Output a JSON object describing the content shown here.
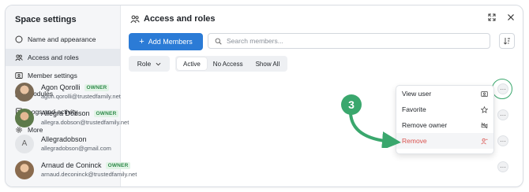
{
  "sidebar": {
    "title": "Space settings",
    "items": [
      {
        "label": "Name and appearance",
        "icon": "circle-icon",
        "active": false
      },
      {
        "label": "Access and roles",
        "icon": "people-icon",
        "active": true
      },
      {
        "label": "Member settings",
        "icon": "id-card-icon",
        "active": false
      },
      {
        "label": "Modules",
        "icon": "modules-icon",
        "active": false
      },
      {
        "label": "Logs and activity",
        "icon": "document-icon",
        "active": false
      },
      {
        "label": "More",
        "icon": "gear-icon",
        "active": false
      }
    ]
  },
  "main": {
    "title": "Access and roles",
    "title_icon": "people-icon"
  },
  "toolbar": {
    "add_label": "Add Members",
    "search_placeholder": "Search members...",
    "sort_icon": "sort-icon"
  },
  "filters": {
    "role_label": "Role",
    "tabs": [
      {
        "label": "Active",
        "active": true
      },
      {
        "label": "No Access",
        "active": false
      },
      {
        "label": "Show All",
        "active": false
      }
    ]
  },
  "members": [
    {
      "name": "Agon Qorolli",
      "badge": "OWNER",
      "email": "agon.qorolli@trustedfamily.net"
    },
    {
      "name": "Allegra Dobson",
      "badge": "OWNER",
      "email": "allegra.dobson@trustedfamily.net"
    },
    {
      "name": "Allegradobson",
      "badge": "",
      "email": "allegradobson@gmail.com",
      "initial": "A"
    },
    {
      "name": "Arnaud de Coninck",
      "badge": "OWNER",
      "email": "arnaud.deconinck@trustedfamily.net"
    }
  ],
  "context_menu": {
    "items": [
      {
        "label": "View user",
        "icon": "profile-card-icon"
      },
      {
        "label": "Favorite",
        "icon": "star-icon"
      },
      {
        "label": "Remove owner",
        "icon": "crown-off-icon"
      },
      {
        "label": "Remove",
        "icon": "user-remove-icon"
      }
    ]
  },
  "annotation": {
    "step": "3"
  },
  "colors": {
    "accent": "#2b7bd6",
    "annotation_green": "#3aa76d",
    "owner_badge": "#2f8a4a",
    "danger": "#d9534f"
  }
}
